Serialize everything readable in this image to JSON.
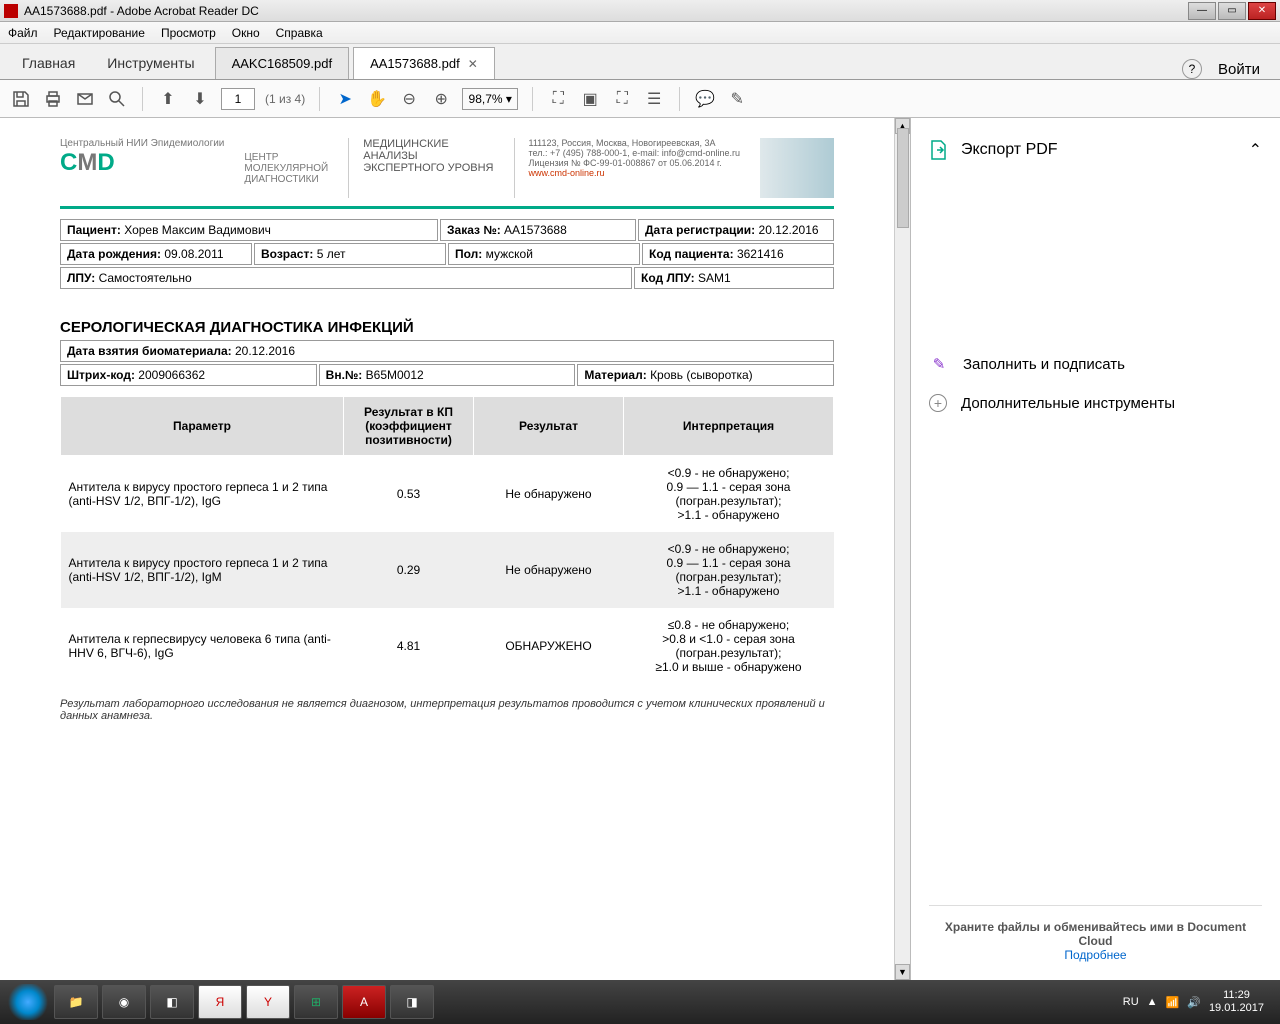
{
  "window": {
    "title": "AA1573688.pdf - Adobe Acrobat Reader DC"
  },
  "menu": {
    "file": "Файл",
    "edit": "Редактирование",
    "view": "Просмотр",
    "window": "Окно",
    "help": "Справка"
  },
  "apptabs": {
    "home": "Главная",
    "tools": "Инструменты"
  },
  "doctabs": [
    {
      "label": "AAKC168509.pdf",
      "active": false
    },
    {
      "label": "AA1573688.pdf",
      "active": true
    }
  ],
  "login": "Войти",
  "toolbar": {
    "page": "1",
    "pagecount": "(1 из 4)",
    "zoom": "98,7%"
  },
  "letterhead": {
    "top": "Центральный НИИ Эпидемиологии",
    "sub1": "ЦЕНТР",
    "sub2": "МОЛЕКУЛЯРНОЙ",
    "sub3": "ДИАГНОСТИКИ",
    "mid1": "МЕДИЦИНСКИЕ",
    "mid2": "АНАЛИЗЫ",
    "mid3": "ЭКСПЕРТНОГО УРОВНЯ",
    "addr": "111123, Россия, Москва, Новогиреевская, 3А",
    "tel": "тел.: +7 (495) 788-000-1, e-mail: info@cmd-online.ru",
    "lic": "Лицензия № ФС-99-01-008867 от 05.06.2014 г.",
    "url": "www.cmd-online.ru"
  },
  "patient": {
    "name_label": "Пациент:",
    "name": "Хорев Максим Вадимович",
    "order_label": "Заказ №:",
    "order": "AA1573688",
    "reg_label": "Дата регистрации:",
    "reg": "20.12.2016",
    "dob_label": "Дата рождения:",
    "dob": "09.08.2011",
    "age_label": "Возраст:",
    "age": "5 лет",
    "sex_label": "Пол:",
    "sex": "мужской",
    "code_label": "Код пациента:",
    "code": "3621416",
    "lpu_label": "ЛПУ:",
    "lpu": "Самостоятельно",
    "lpucode_label": "Код ЛПУ:",
    "lpucode": "SAM1"
  },
  "section": "СЕРОЛОГИЧЕСКАЯ ДИАГНОСТИКА ИНФЕКЦИЙ",
  "meta": {
    "sample_date_label": "Дата взятия биоматериала:",
    "sample_date": "20.12.2016",
    "barcode_label": "Штрих-код:",
    "barcode": "2009066362",
    "vn_label": "Вн.№:",
    "vn": "B65M0012",
    "material_label": "Материал:",
    "material": "Кровь (сыворотка)"
  },
  "table": {
    "headers": {
      "param": "Параметр",
      "kp": "Результат в КП (коэффициент позитивности)",
      "result": "Результат",
      "interp": "Интерпретация"
    },
    "rows": [
      {
        "param": "Антитела к вирусу простого герпеса 1 и 2 типа (anti-HSV 1/2, ВПГ-1/2), IgG",
        "kp": "0.53",
        "result": "Не обнаружено",
        "interp": "<0.9 - не обнаружено;\n0.9 — 1.1 - серая зона (погран.результат);\n>1.1 - обнаружено"
      },
      {
        "param": "Антитела к вирусу простого герпеса 1 и 2 типа (anti-HSV 1/2, ВПГ-1/2), IgM",
        "kp": "0.29",
        "result": "Не обнаружено",
        "interp": "<0.9 - не обнаружено;\n0.9 — 1.1 - серая зона (погран.результат);\n>1.1 - обнаружено"
      },
      {
        "param": "Антитела к герпесвирусу человека 6 типа (anti-HHV 6, ВГЧ-6), IgG",
        "kp": "4.81",
        "result": "ОБНАРУЖЕНО",
        "interp": "≤0.8 - не обнаружено;\n>0.8 и <1.0 - серая зона (погран.результат);\n≥1.0 и выше - обнаружено"
      }
    ]
  },
  "footnote": "Результат лабораторного исследования не является диагнозом, интерпретация результатов проводится с учетом клинических проявлений и данных анамнеза.",
  "sidebar": {
    "export": "Экспорт PDF",
    "fill_sign": "Заполнить и подписать",
    "more_tools": "Дополнительные инструменты",
    "foot1": "Храните файлы и обменивайтесь ими в Document Cloud",
    "foot2": "Подробнее"
  },
  "tray": {
    "lang": "RU",
    "time": "11:29",
    "date": "19.01.2017"
  }
}
